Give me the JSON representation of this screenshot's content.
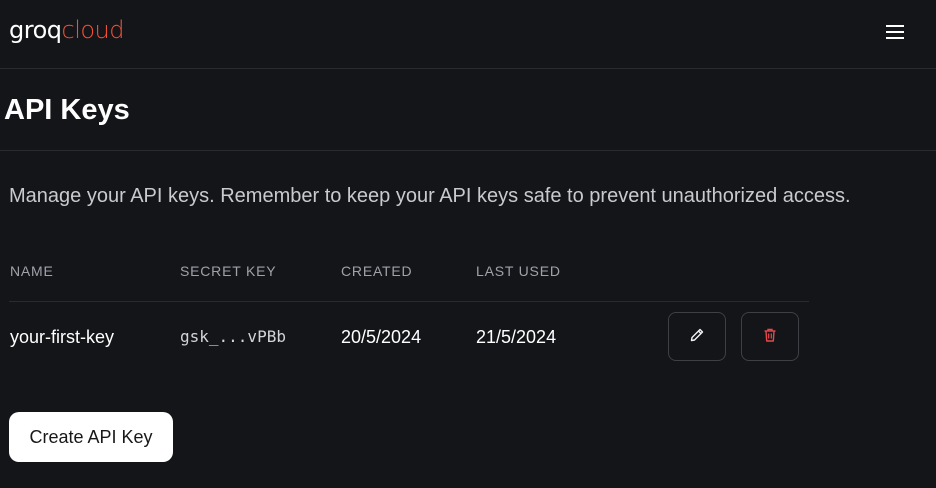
{
  "brand": {
    "logo_part1": "groq",
    "logo_part2": "cloud",
    "accent": "#f55036"
  },
  "header": {
    "menu_icon": "hamburger-menu-icon"
  },
  "page": {
    "title": "API Keys",
    "description": "Manage your API keys. Remember to keep your API keys safe to prevent unauthorized access."
  },
  "table": {
    "columns": [
      "NAME",
      "SECRET KEY",
      "CREATED",
      "LAST USED"
    ],
    "rows": [
      {
        "name": "your-first-key",
        "secret": "gsk_...vPBb",
        "created": "20/5/2024",
        "last_used": "21/5/2024",
        "edit_icon": "pencil-icon",
        "delete_icon": "trash-icon"
      }
    ]
  },
  "actions": {
    "create_label": "Create API Key"
  },
  "colors": {
    "background": "#141519",
    "delete": "#e5484d"
  }
}
